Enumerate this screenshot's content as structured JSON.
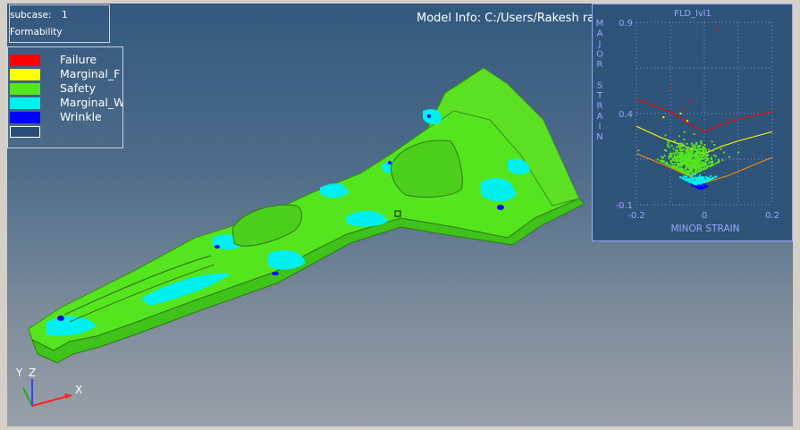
{
  "info": {
    "subcase_label": "subcase:",
    "subcase_value": "1",
    "result_type": "Formability",
    "model_info": "Model Info: C:/Users/Rakesh rakh"
  },
  "legend": [
    {
      "label": "Failure",
      "color": "#ff0000"
    },
    {
      "label": "Marginal_F",
      "color": "#ffff00"
    },
    {
      "label": "Safety",
      "color": "#55e51f"
    },
    {
      "label": "Marginal_W",
      "color": "#00f0f0"
    },
    {
      "label": "Wrinkle",
      "color": "#0000ff"
    },
    {
      "label": "",
      "color": "#2b4f74"
    }
  ],
  "fld": {
    "title": "FLD_lvl1",
    "ylabel": "MAJOR STRAIN",
    "xlabel": "MINOR STRAIN",
    "y_ticks": [
      "0.9",
      "0.4",
      "-0.1"
    ],
    "x_ticks": [
      "-0.2",
      "0",
      "0.2"
    ],
    "axis_color": "#9aa6ff",
    "label_color": "#9aa6ff"
  },
  "chart_data": {
    "type": "scatter",
    "title": "FLD_lvl1",
    "xlabel": "MINOR STRAIN",
    "ylabel": "MAJOR STRAIN",
    "xlim": [
      -0.2,
      0.2
    ],
    "ylim": [
      -0.1,
      0.9
    ],
    "grid": true,
    "series": [
      {
        "color": "#ff0000",
        "kind": "line",
        "x": [
          -0.2,
          -0.13,
          -0.09,
          -0.05,
          0.0,
          0.05,
          0.1,
          0.2
        ],
        "y": [
          0.48,
          0.43,
          0.4,
          0.35,
          0.3,
          0.34,
          0.37,
          0.41
        ]
      },
      {
        "color": "#ffff00",
        "kind": "line",
        "x": [
          -0.2,
          -0.13,
          -0.07,
          0.0,
          0.05,
          0.1,
          0.2
        ],
        "y": [
          0.33,
          0.27,
          0.23,
          0.18,
          0.22,
          0.25,
          0.3
        ]
      },
      {
        "color": "#ff8c00",
        "kind": "line",
        "x": [
          -0.2,
          -0.12,
          -0.06,
          0.0,
          0.07,
          0.2
        ],
        "y": [
          0.18,
          0.12,
          0.07,
          0.02,
          0.06,
          0.16
        ]
      },
      {
        "color": "#ff0000",
        "kind": "scatter",
        "x": [
          0.04,
          -0.1,
          -0.04,
          -0.06
        ],
        "y": [
          0.86,
          0.55,
          0.47,
          0.42
        ]
      },
      {
        "color": "#ffff00",
        "kind": "scatter",
        "x": [
          -0.07,
          -0.05,
          -0.12
        ],
        "y": [
          0.4,
          0.36,
          0.38
        ]
      },
      {
        "color": "#55e51f",
        "kind": "cloud",
        "center": [
          -0.04,
          0.14
        ],
        "spread": [
          0.06,
          0.08
        ],
        "count": 650
      },
      {
        "color": "#00f0f0",
        "kind": "cloud",
        "center": [
          -0.02,
          0.03
        ],
        "spread": [
          0.035,
          0.025
        ],
        "count": 170
      },
      {
        "color": "#0000ff",
        "kind": "cloud",
        "center": [
          -0.01,
          -0.005
        ],
        "spread": [
          0.02,
          0.01
        ],
        "count": 60
      }
    ]
  },
  "triad": {
    "y": "Y",
    "z": "Z",
    "x": "X"
  }
}
